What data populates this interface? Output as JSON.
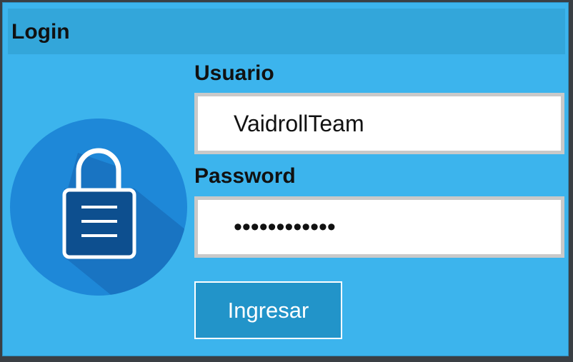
{
  "window": {
    "title": "Login"
  },
  "form": {
    "user_label": "Usuario",
    "user_value": "VaidrollTeam",
    "password_label": "Password",
    "password_value": "••••••••••••",
    "submit_label": "Ingresar"
  },
  "icons": {
    "lock": "padlock-icon"
  },
  "colors": {
    "background": "#3cb4ed",
    "titlebar": "#33a6da",
    "circle": "#1e88d8",
    "button": "#2294c9",
    "frame": "#3a3f44"
  }
}
